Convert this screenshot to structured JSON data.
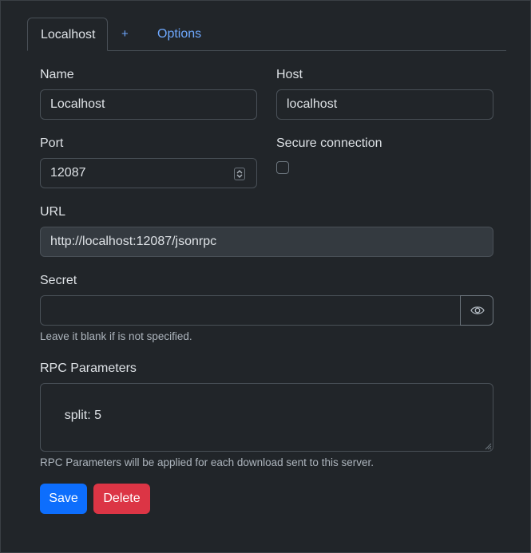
{
  "tabs": {
    "server_tab": "Localhost",
    "add_tab": "+",
    "options_tab": "Options"
  },
  "form": {
    "name": {
      "label": "Name",
      "value": "Localhost"
    },
    "host": {
      "label": "Host",
      "value": "localhost"
    },
    "port": {
      "label": "Port",
      "value": "12087"
    },
    "secure": {
      "label": "Secure connection",
      "checked": false
    },
    "url": {
      "label": "URL",
      "value": "http://localhost:12087/jsonrpc"
    },
    "secret": {
      "label": "Secret",
      "value": "",
      "help": "Leave it blank if is not specified."
    },
    "rpc": {
      "label": "RPC Parameters",
      "value": "split: 5",
      "help": "RPC Parameters will be applied for each download sent to this server."
    }
  },
  "buttons": {
    "save": "Save",
    "delete": "Delete"
  },
  "colors": {
    "background": "#212529",
    "border": "#495057",
    "link": "#6ea8fe",
    "primary": "#0d6efd",
    "danger": "#dc3545",
    "disabled_field": "#343a40"
  },
  "icons": {
    "port_spinner": "up-down-spinner-icon",
    "secret_toggle": "eye-icon",
    "textarea_resize": "resize-grip-icon"
  }
}
